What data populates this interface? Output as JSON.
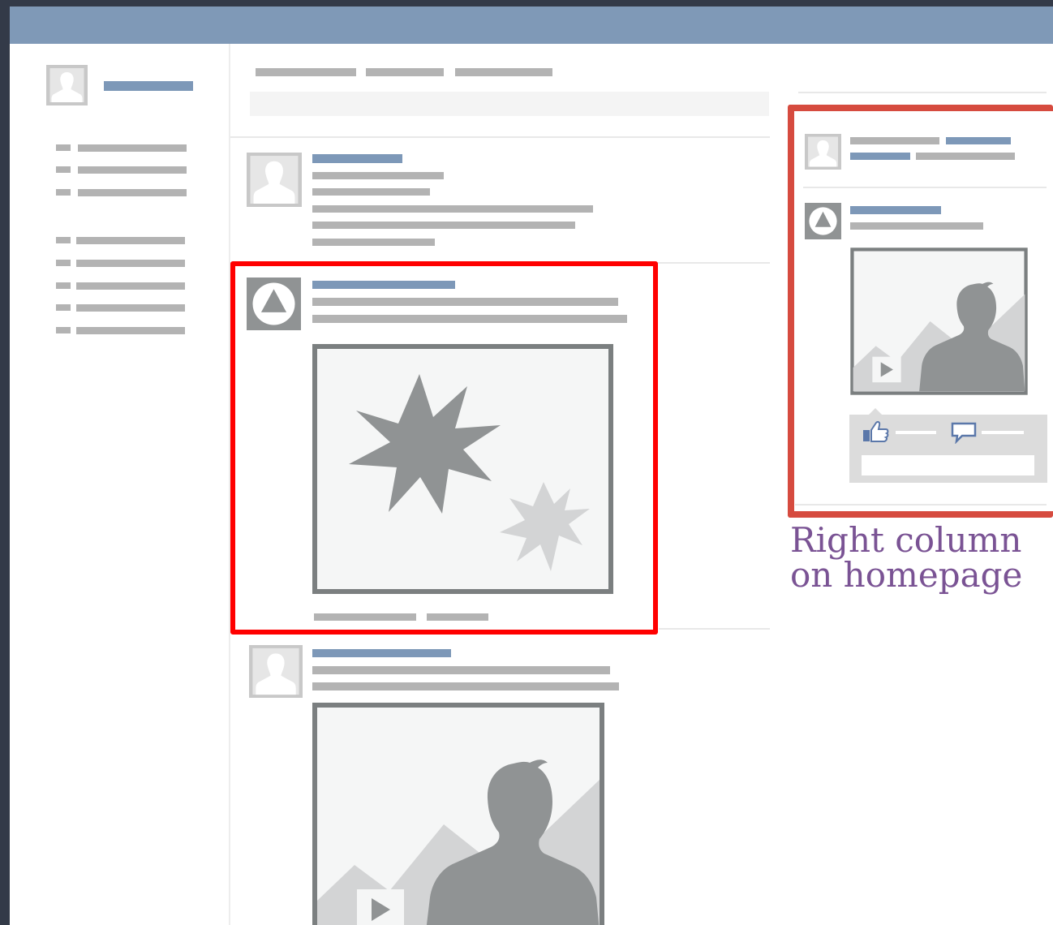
{
  "colors": {
    "topbar": "#7f99b7",
    "link_bar": "#7d98b8",
    "primary_highlight": "#ff0000",
    "secondary_highlight": "#d64b3f",
    "caption": "#7a5394",
    "placeholder_gray": "#b3b3b3",
    "media_frame": "#7b7f80",
    "media_bg": "#f5f6f6",
    "media_dark": "#909394",
    "media_light": "#d3d4d5"
  },
  "sidebar": {
    "avatar_icon": "person-silhouette-icon",
    "list_groups": [
      3,
      5
    ]
  },
  "feed": {
    "posts": [
      {
        "icon": "person-silhouette-icon",
        "media": "none"
      },
      {
        "icon": "triangle-circle-icon",
        "media": "starburst-image-icon",
        "highlighted": true
      },
      {
        "icon": "person-silhouette-icon",
        "media": "video-thumbnail-icon"
      }
    ]
  },
  "right_column": {
    "ad_icons": [
      "person-silhouette-icon",
      "triangle-circle-icon",
      "video-thumbnail-icon",
      "thumbs-up-icon",
      "comment-bubble-icon"
    ],
    "caption_line1": "Right column",
    "caption_line2": "on homepage"
  }
}
